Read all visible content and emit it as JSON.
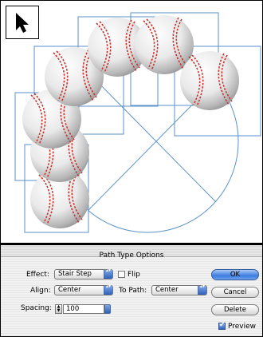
{
  "dialog": {
    "title": "Path Type Options",
    "effect_label": "Effect:",
    "effect_value": "Stair Step",
    "flip_label": "Flip",
    "flip_checked": false,
    "align_label": "Align:",
    "align_value": "Center",
    "to_path_label": "To Path:",
    "to_path_value": "Center",
    "spacing_label": "Spacing:",
    "spacing_value": "100",
    "ok_label": "OK",
    "cancel_label": "Cancel",
    "delete_label": "Delete",
    "preview_label": "Preview",
    "preview_checked": true
  },
  "canvas": {
    "object": "baseball",
    "ball_count": 7,
    "frame_color": "#5b92c8",
    "stitch_color": "#c8332f",
    "tool_icon": "selection-arrow-icon"
  }
}
